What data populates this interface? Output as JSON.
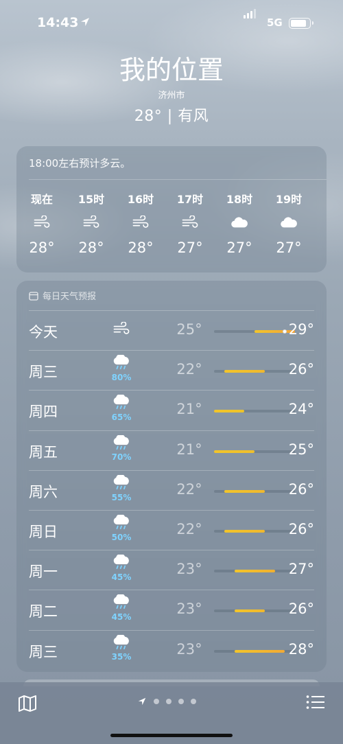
{
  "status_bar": {
    "time": "14:43",
    "network": "5G"
  },
  "header": {
    "title": "我的位置",
    "city": "济州市",
    "summary": "28° | 有风"
  },
  "hourly": {
    "note": "18:00左右预计多云。",
    "items": [
      {
        "label": "现在",
        "icon": "wind-icon",
        "temp": "28°"
      },
      {
        "label": "15时",
        "icon": "wind-icon",
        "temp": "28°"
      },
      {
        "label": "16时",
        "icon": "wind-icon",
        "temp": "28°"
      },
      {
        "label": "17时",
        "icon": "wind-icon",
        "temp": "27°"
      },
      {
        "label": "18时",
        "icon": "cloud-icon",
        "temp": "27°"
      },
      {
        "label": "19时",
        "icon": "cloud-icon",
        "temp": "27°"
      }
    ]
  },
  "daily": {
    "header": "每日天气预报",
    "range": {
      "min": 21,
      "max": 29
    },
    "days": [
      {
        "name": "今天",
        "icon": "wind-icon",
        "rain": "",
        "low": "25°",
        "high": "29°",
        "low_val": 25,
        "high_val": 29,
        "current_val": 28,
        "bar_color": "#f4a53a"
      },
      {
        "name": "周三",
        "icon": "rain-cloud-icon",
        "rain": "80%",
        "low": "22°",
        "high": "26°",
        "low_val": 22,
        "high_val": 26,
        "bar_color": "#f0b82e"
      },
      {
        "name": "周四",
        "icon": "rain-cloud-icon",
        "rain": "65%",
        "low": "21°",
        "high": "24°",
        "low_val": 21,
        "high_val": 24,
        "bar_color": "#eec42a"
      },
      {
        "name": "周五",
        "icon": "rain-cloud-icon",
        "rain": "70%",
        "low": "21°",
        "high": "25°",
        "low_val": 21,
        "high_val": 25,
        "bar_color": "#efbf2c"
      },
      {
        "name": "周六",
        "icon": "rain-cloud-icon",
        "rain": "55%",
        "low": "22°",
        "high": "26°",
        "low_val": 22,
        "high_val": 26,
        "bar_color": "#f0b82e"
      },
      {
        "name": "周日",
        "icon": "rain-cloud-icon",
        "rain": "50%",
        "low": "22°",
        "high": "26°",
        "low_val": 22,
        "high_val": 26,
        "bar_color": "#f0b82e"
      },
      {
        "name": "周一",
        "icon": "rain-cloud-icon",
        "rain": "45%",
        "low": "23°",
        "high": "27°",
        "low_val": 23,
        "high_val": 27,
        "bar_color": "#f1b030"
      },
      {
        "name": "周二",
        "icon": "rain-cloud-icon",
        "rain": "45%",
        "low": "23°",
        "high": "26°",
        "low_val": 23,
        "high_val": 26,
        "bar_color": "#f0b82e"
      },
      {
        "name": "周三",
        "icon": "rain-cloud-icon",
        "rain": "35%",
        "low": "23°",
        "high": "28°",
        "low_val": 23,
        "high_val": 28,
        "bar_color": "#f2aa34"
      }
    ]
  },
  "tabbar": {
    "page_count": 4
  }
}
